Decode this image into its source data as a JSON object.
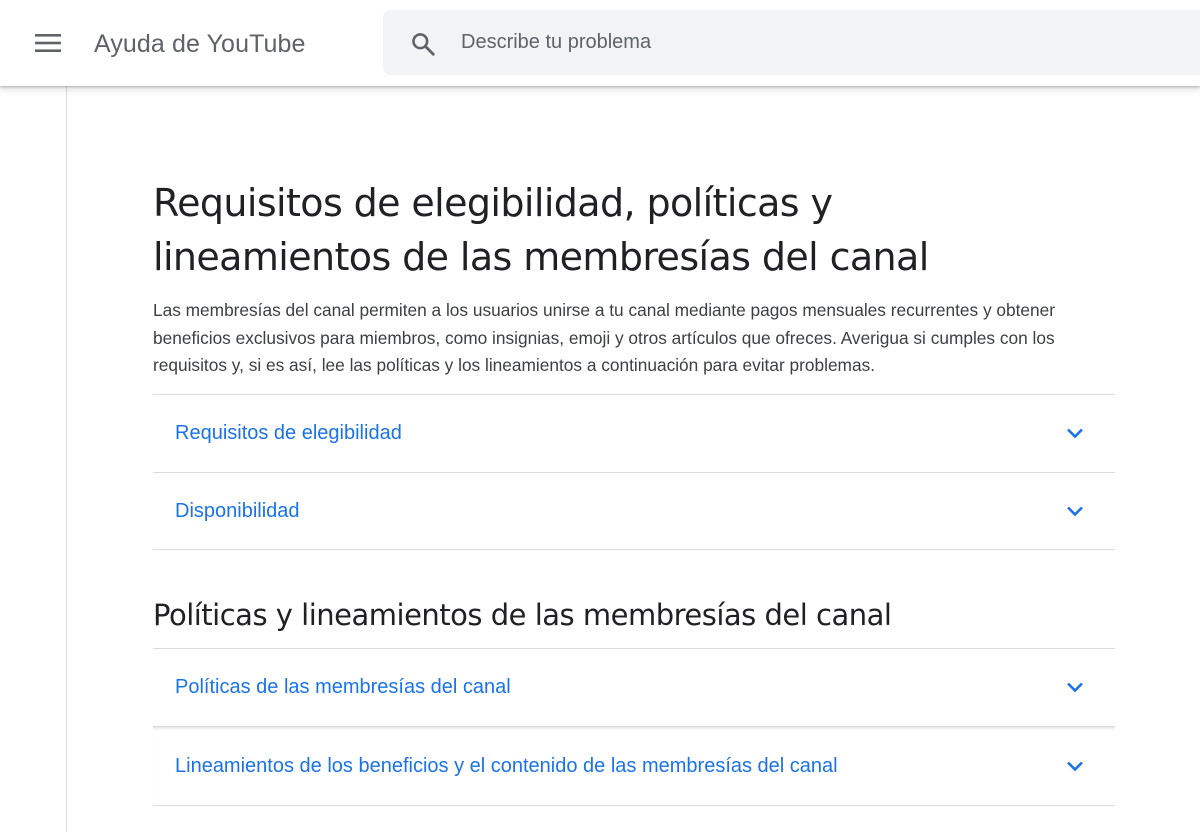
{
  "header": {
    "app_title": "Ayuda de YouTube",
    "menu_icon": "hamburger-menu-icon",
    "search": {
      "icon": "search-icon",
      "placeholder": "Describe tu problema",
      "value": ""
    }
  },
  "article": {
    "title": "Requisitos de elegibilidad, políticas y lineamientos de las membresías del canal",
    "intro": "Las membresías del canal permiten a los usuarios unirse a tu canal mediante pagos mensuales recurrentes y obtener beneficios exclusivos para miembros, como insignias, emoji y otros artículos que ofreces. Averigua si cumples con los requisitos y, si es así, lee las políticas y los lineamientos a continuación para evitar problemas.",
    "sections_top": [
      {
        "label": "Requisitos de elegibilidad",
        "icon": "chevron-down-icon"
      },
      {
        "label": "Disponibilidad",
        "icon": "chevron-down-icon"
      }
    ],
    "policies_heading": "Políticas y lineamientos de las membresías del canal",
    "sections_policies": [
      {
        "label": "Políticas de las membresías del canal",
        "icon": "chevron-down-icon"
      },
      {
        "label": "Lineamientos de los beneficios y el contenido de las membresías del canal",
        "icon": "chevron-down-icon"
      }
    ]
  },
  "colors": {
    "link": "#1a73e8",
    "title_text": "#202124",
    "body_text": "#3c4043",
    "muted": "#5f6368",
    "search_bg": "#f1f3f4",
    "divider": "#dadce0"
  }
}
